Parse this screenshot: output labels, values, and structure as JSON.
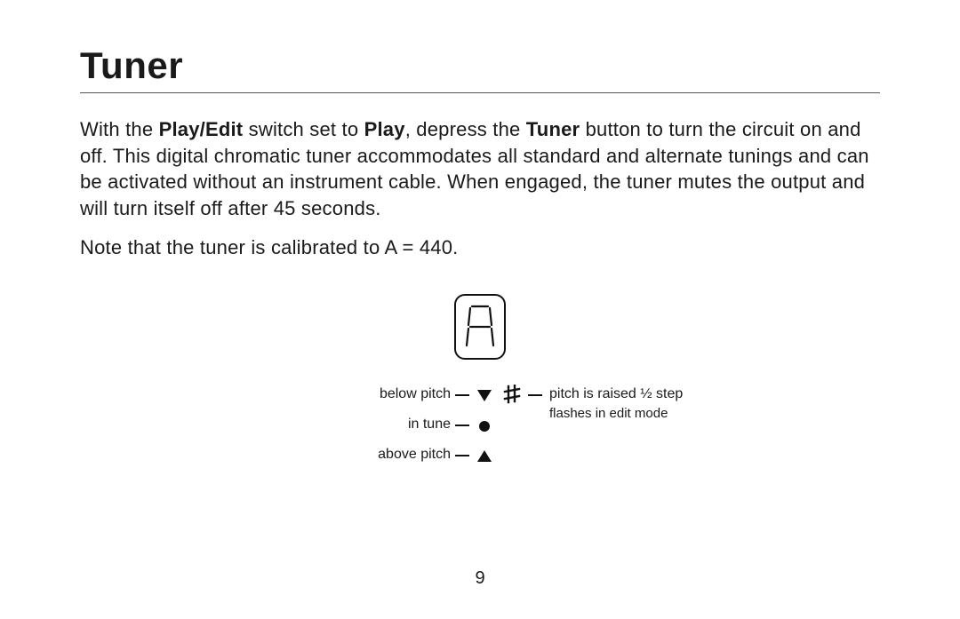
{
  "title": "Tuner",
  "para1": {
    "seg1": "With the ",
    "bold1": "Play/Edit",
    "seg2": " switch set to ",
    "bold2": "Play",
    "seg3": ", depress the ",
    "bold3": "Tuner",
    "seg4": " button to turn the circuit on and off. This digital chromatic tuner accommodates all standard and alternate tunings and can be activated without an instrument cable. When engaged, the tuner mutes the output and will turn itself off after 45 seconds."
  },
  "para2": "Note that the tuner is calibrated to A = 440.",
  "legend": {
    "below": "below pitch",
    "in_tune": "in tune",
    "above": "above pitch",
    "sharp_line1": "pitch is raised ½ step",
    "sharp_line2": "flashes in edit mode"
  },
  "page_number": "9",
  "icons": {
    "display": "seven-segment-a",
    "down": "triangle-down",
    "dot": "circle",
    "up": "triangle-up",
    "sharp": "sharp-sign"
  }
}
